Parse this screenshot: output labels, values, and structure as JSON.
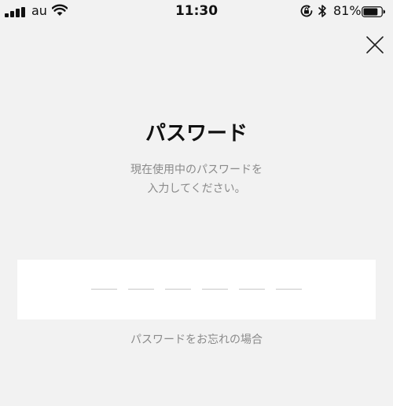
{
  "status_bar": {
    "carrier": "au",
    "time": "11:30",
    "battery_percent": "81%",
    "icons": [
      "signal-icon",
      "wifi-icon",
      "rotation-lock-icon",
      "bluetooth-icon",
      "battery-icon"
    ],
    "battery_level": 0.81
  },
  "header": {
    "close_icon": "close-icon"
  },
  "main": {
    "title": "パスワード",
    "instruction_lines": [
      "現在使用中のパスワードを",
      "入力してください。"
    ],
    "code_length": 6,
    "forgot_link": "パスワードをお忘れの場合"
  },
  "colors": {
    "background": "#f2f2f2",
    "field": "#ffffff",
    "secondary_text": "#8a8a8a",
    "slot_line": "#c8c8c8"
  }
}
